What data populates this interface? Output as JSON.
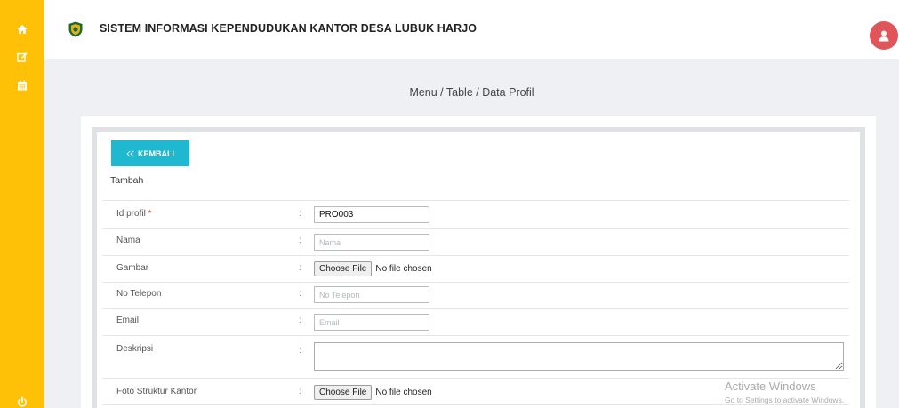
{
  "sidebar": {
    "icons": [
      "home-icon",
      "edit-icon",
      "calendar-icon",
      "power-icon"
    ],
    "color": "#ffc107"
  },
  "header": {
    "title": "SISTEM INFORMASI KEPENDUDUKAN KANTOR DESA LUBUK HARJO",
    "logo": "shield-logo-icon",
    "avatar_icon": "user-icon",
    "avatar_color": "#e0555a"
  },
  "breadcrumb": "Menu / Table / Data Profil",
  "form": {
    "back_label": "KEMBALI",
    "back_color": "#1eb9d1",
    "section_title": "Tambah",
    "colon": ":",
    "fields": {
      "id_profil": {
        "label": "Id profil",
        "required_mark": "*",
        "value": "PRO003"
      },
      "nama": {
        "label": "Nama",
        "placeholder": "Nama"
      },
      "gambar": {
        "label": "Gambar",
        "button": "Choose File",
        "status": "No file chosen"
      },
      "no_telepon": {
        "label": "No Telepon",
        "placeholder": "No Telepon"
      },
      "email": {
        "label": "Email",
        "placeholder": "Email"
      },
      "deskripsi": {
        "label": "Deskripsi"
      },
      "foto_struktur": {
        "label": "Foto Struktur Kantor",
        "button": "Choose File",
        "status": "No file chosen"
      }
    }
  },
  "watermark": {
    "title": "Activate Windows",
    "subtitle": "Go to Settings to activate Windows."
  }
}
